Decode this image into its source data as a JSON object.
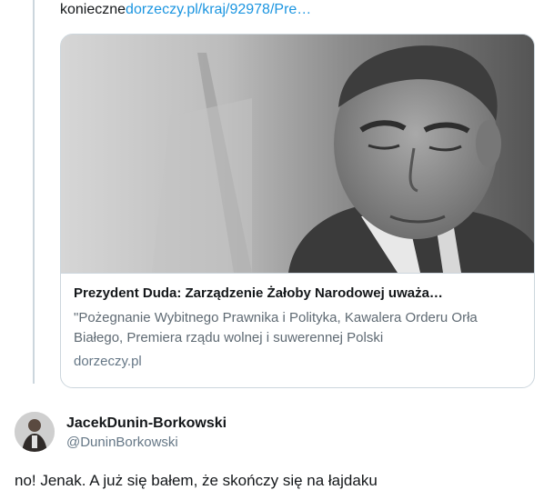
{
  "previous_tweet": {
    "text_prefix": "konieczne",
    "link_text": "dorzeczy.pl/kraj/92978/Pre…"
  },
  "link_card": {
    "title": "Prezydent Duda: Zarządzenie Żałoby Narodowej uważa…",
    "description": "\"Pożegnanie Wybitnego Prawnika i Polityka, Kawalera Orderu Orła Białego, Premiera rządu wolnej i suwerennej Polski",
    "domain": "dorzeczy.pl"
  },
  "reply": {
    "display_name": "JacekDunin-Borkowski",
    "handle": "@DuninBorkowski",
    "text": "no! Jenak. A już się bałem, że skończy się na łajdaku"
  }
}
